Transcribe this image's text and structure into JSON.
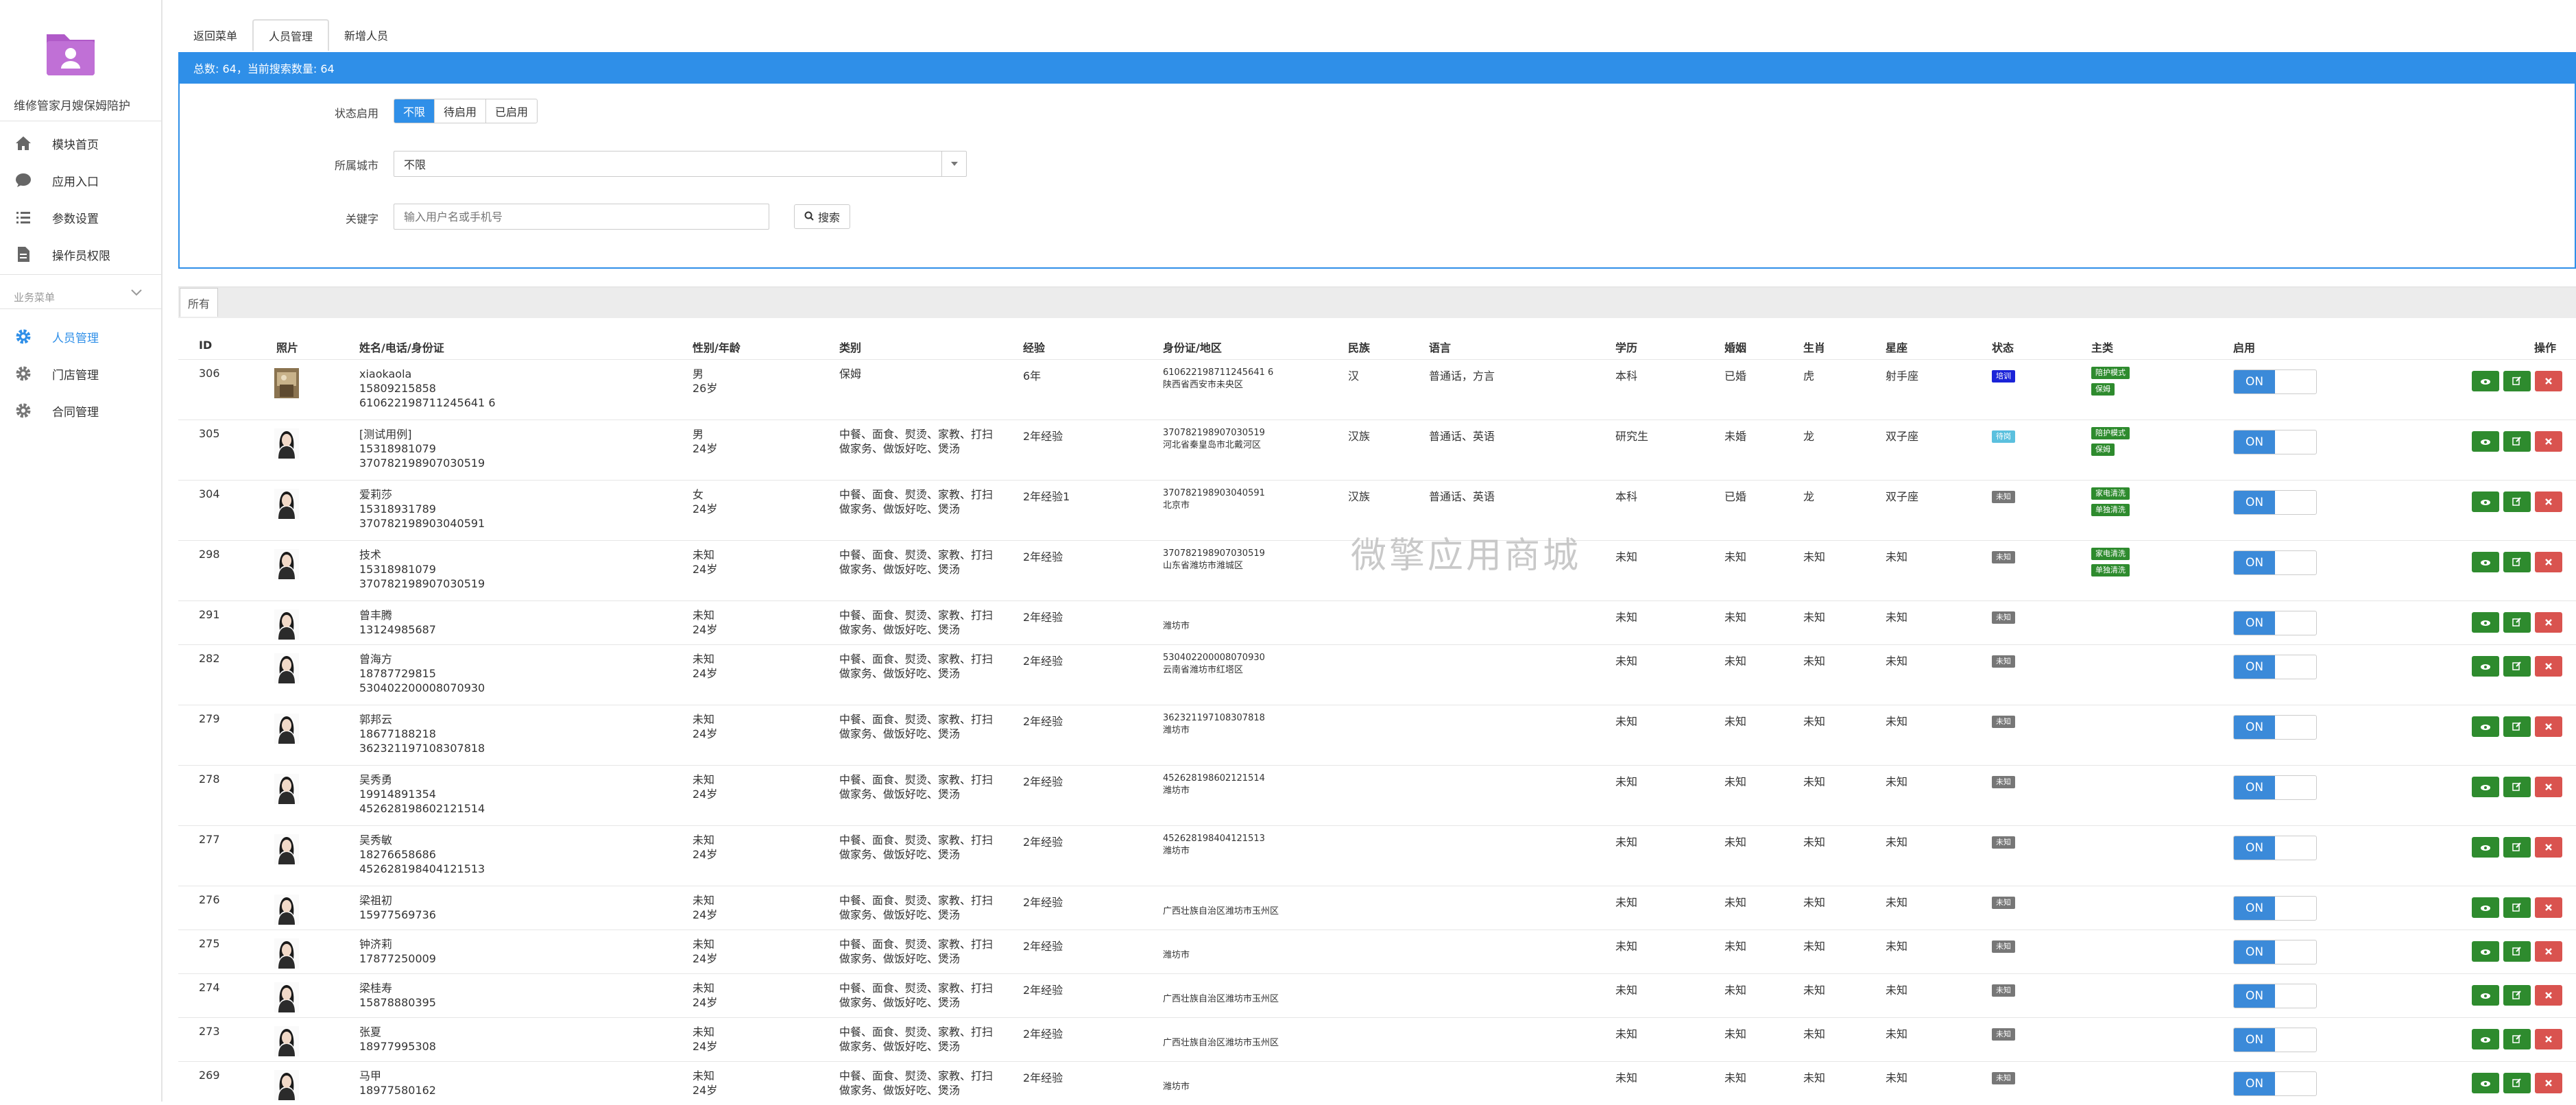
{
  "sidebar": {
    "app_name": "维修管家月嫂保姆陪护",
    "items": [
      {
        "label": "模块首页",
        "icon": "home-icon"
      },
      {
        "label": "应用入口",
        "icon": "chat-icon"
      },
      {
        "label": "参数设置",
        "icon": "list-settings-icon"
      },
      {
        "label": "操作员权限",
        "icon": "document-icon"
      }
    ],
    "section_title": "业务菜单",
    "biz_items": [
      {
        "label": "人员管理",
        "icon": "gear-icon",
        "active": true
      },
      {
        "label": "门店管理",
        "icon": "gear-icon"
      },
      {
        "label": "合同管理",
        "icon": "gear-icon"
      }
    ]
  },
  "tabs": [
    "返回菜单",
    "人员管理",
    "新增人员"
  ],
  "stats": "总数: 64，当前搜索数量:  64",
  "filters": {
    "status_label": "状态启用",
    "status_options": [
      "不限",
      "待启用",
      "已启用"
    ],
    "city_label": "所属城市",
    "city_value": "不限",
    "keyword_label": "关键字",
    "keyword_placeholder": "输入用户名或手机号",
    "search_label": "搜索"
  },
  "group_tab": "所有",
  "columns": [
    "ID",
    "照片",
    "姓名/电话/身份证",
    "性别/年龄",
    "类别",
    "经验",
    "身份证/地区",
    "民族",
    "语言",
    "学历",
    "婚姻",
    "生肖",
    "星座",
    "状态",
    "主类",
    "启用",
    "操作"
  ],
  "toggle_label": "ON",
  "watermark": "微擎应用商城",
  "colors": {
    "accent": "#2f8fe8",
    "green": "#2e8b2e",
    "red": "#d9534f",
    "status_grey": "#777777",
    "status_blue": "#1a23d8",
    "status_light": "#5bc0de"
  },
  "rows": [
    {
      "id": "306",
      "name": "xiaokaola",
      "phone": "15809215858",
      "idcard": "610622198711245641 6",
      "sex": "男",
      "age": "26岁",
      "cat1": "保姆",
      "cat2": "",
      "exp": "6年",
      "id2": "610622198711245641 6",
      "region": "陕西省西安市未央区",
      "nation": "汉",
      "lang": "普通话，方言",
      "edu": "本科",
      "marriage": "已婚",
      "zodiac": "虎",
      "star": "射手座",
      "status": "培训",
      "status_type": "blue",
      "main": [
        "陪护模式",
        "保姆"
      ]
    },
    {
      "id": "305",
      "name": "[测试用例]",
      "phone": "15318981079",
      "idcard": "370782198907030519",
      "sex": "男",
      "age": "24岁",
      "cat1": "中餐、面食、熨烫、家教、打扫",
      "cat2": "做家务、做饭好吃、煲汤",
      "exp": "2年经验",
      "id2": "370782198907030519",
      "region": "河北省秦皇岛市北戴河区",
      "nation": "汉族",
      "lang": "普通话、英语",
      "edu": "研究生",
      "marriage": "未婚",
      "zodiac": "龙",
      "star": "双子座",
      "status": "待岗",
      "status_type": "light",
      "main": [
        "陪护模式",
        "保姆"
      ]
    },
    {
      "id": "304",
      "name": "爱莉莎",
      "phone": "15318931789",
      "idcard": "370782198903040591",
      "sex": "女",
      "age": "24岁",
      "cat1": "中餐、面食、熨烫、家教、打扫",
      "cat2": "做家务、做饭好吃、煲汤",
      "exp": "2年经验1",
      "id2": "370782198903040591",
      "region": "北京市",
      "nation": "汉族",
      "lang": "普通话、英语",
      "edu": "本科",
      "marriage": "已婚",
      "zodiac": "龙",
      "star": "双子座",
      "status": "未知",
      "status_type": "grey",
      "main": [
        "家电清洗",
        "单独清洗"
      ]
    },
    {
      "id": "298",
      "name": "技术",
      "phone": "15318981079",
      "idcard": "370782198907030519",
      "sex": "未知",
      "age": "24岁",
      "cat1": "中餐、面食、熨烫、家教、打扫",
      "cat2": "做家务、做饭好吃、煲汤",
      "exp": "2年经验",
      "id2": "370782198907030519",
      "region": "山东省潍坊市潍城区",
      "nation": "",
      "lang": "",
      "edu": "未知",
      "marriage": "未知",
      "zodiac": "未知",
      "star": "未知",
      "status": "未知",
      "status_type": "grey",
      "main": [
        "家电清洗",
        "单独清洗"
      ]
    },
    {
      "id": "291",
      "name": "曾丰腾",
      "phone": "13124985687",
      "idcard": "",
      "sex": "未知",
      "age": "24岁",
      "cat1": "中餐、面食、熨烫、家教、打扫",
      "cat2": "做家务、做饭好吃、煲汤",
      "exp": "2年经验",
      "id2": "",
      "region": "潍坊市",
      "nation": "",
      "lang": "",
      "edu": "未知",
      "marriage": "未知",
      "zodiac": "未知",
      "star": "未知",
      "status": "未知",
      "status_type": "grey",
      "main": []
    },
    {
      "id": "282",
      "name": "曾海方",
      "phone": "18787729815",
      "idcard": "530402200008070930",
      "sex": "未知",
      "age": "24岁",
      "cat1": "中餐、面食、熨烫、家教、打扫",
      "cat2": "做家务、做饭好吃、煲汤",
      "exp": "2年经验",
      "id2": "530402200008070930",
      "region": "云南省潍坊市红塔区",
      "nation": "",
      "lang": "",
      "edu": "未知",
      "marriage": "未知",
      "zodiac": "未知",
      "star": "未知",
      "status": "未知",
      "status_type": "grey",
      "main": []
    },
    {
      "id": "279",
      "name": "郭邦云",
      "phone": "18677188218",
      "idcard": "362321197108307818",
      "sex": "未知",
      "age": "24岁",
      "cat1": "中餐、面食、熨烫、家教、打扫",
      "cat2": "做家务、做饭好吃、煲汤",
      "exp": "2年经验",
      "id2": "362321197108307818",
      "region": "潍坊市",
      "nation": "",
      "lang": "",
      "edu": "未知",
      "marriage": "未知",
      "zodiac": "未知",
      "star": "未知",
      "status": "未知",
      "status_type": "grey",
      "main": []
    },
    {
      "id": "278",
      "name": "吴秀勇",
      "phone": "19914891354",
      "idcard": "452628198602121514",
      "sex": "未知",
      "age": "24岁",
      "cat1": "中餐、面食、熨烫、家教、打扫",
      "cat2": "做家务、做饭好吃、煲汤",
      "exp": "2年经验",
      "id2": "452628198602121514",
      "region": "潍坊市",
      "nation": "",
      "lang": "",
      "edu": "未知",
      "marriage": "未知",
      "zodiac": "未知",
      "star": "未知",
      "status": "未知",
      "status_type": "grey",
      "main": []
    },
    {
      "id": "277",
      "name": "吴秀敏",
      "phone": "18276658686",
      "idcard": "452628198404121513",
      "sex": "未知",
      "age": "24岁",
      "cat1": "中餐、面食、熨烫、家教、打扫",
      "cat2": "做家务、做饭好吃、煲汤",
      "exp": "2年经验",
      "id2": "452628198404121513",
      "region": "潍坊市",
      "nation": "",
      "lang": "",
      "edu": "未知",
      "marriage": "未知",
      "zodiac": "未知",
      "star": "未知",
      "status": "未知",
      "status_type": "grey",
      "main": []
    },
    {
      "id": "276",
      "name": "梁祖初",
      "phone": "15977569736",
      "idcard": "",
      "sex": "未知",
      "age": "24岁",
      "cat1": "中餐、面食、熨烫、家教、打扫",
      "cat2": "做家务、做饭好吃、煲汤",
      "exp": "2年经验",
      "id2": "",
      "region": "广西壮族自治区潍坊市玉州区",
      "nation": "",
      "lang": "",
      "edu": "未知",
      "marriage": "未知",
      "zodiac": "未知",
      "star": "未知",
      "status": "未知",
      "status_type": "grey",
      "main": []
    },
    {
      "id": "275",
      "name": "钟济莉",
      "phone": "17877250009",
      "idcard": "",
      "sex": "未知",
      "age": "24岁",
      "cat1": "中餐、面食、熨烫、家教、打扫",
      "cat2": "做家务、做饭好吃、煲汤",
      "exp": "2年经验",
      "id2": "",
      "region": "潍坊市",
      "nation": "",
      "lang": "",
      "edu": "未知",
      "marriage": "未知",
      "zodiac": "未知",
      "star": "未知",
      "status": "未知",
      "status_type": "grey",
      "main": []
    },
    {
      "id": "274",
      "name": "梁桂寿",
      "phone": "15878880395",
      "idcard": "",
      "sex": "未知",
      "age": "24岁",
      "cat1": "中餐、面食、熨烫、家教、打扫",
      "cat2": "做家务、做饭好吃、煲汤",
      "exp": "2年经验",
      "id2": "",
      "region": "广西壮族自治区潍坊市玉州区",
      "nation": "",
      "lang": "",
      "edu": "未知",
      "marriage": "未知",
      "zodiac": "未知",
      "star": "未知",
      "status": "未知",
      "status_type": "grey",
      "main": []
    },
    {
      "id": "273",
      "name": "张夏",
      "phone": "18977995308",
      "idcard": "",
      "sex": "未知",
      "age": "24岁",
      "cat1": "中餐、面食、熨烫、家教、打扫",
      "cat2": "做家务、做饭好吃、煲汤",
      "exp": "2年经验",
      "id2": "",
      "region": "广西壮族自治区潍坊市玉州区",
      "nation": "",
      "lang": "",
      "edu": "未知",
      "marriage": "未知",
      "zodiac": "未知",
      "star": "未知",
      "status": "未知",
      "status_type": "grey",
      "main": []
    },
    {
      "id": "269",
      "name": "马甲",
      "phone": "18977580162",
      "idcard": "",
      "sex": "未知",
      "age": "24岁",
      "cat1": "中餐、面食、熨烫、家教、打扫",
      "cat2": "做家务、做饭好吃、煲汤",
      "exp": "2年经验",
      "id2": "",
      "region": "潍坊市",
      "nation": "",
      "lang": "",
      "edu": "未知",
      "marriage": "未知",
      "zodiac": "未知",
      "star": "未知",
      "status": "未知",
      "status_type": "grey",
      "main": []
    }
  ]
}
